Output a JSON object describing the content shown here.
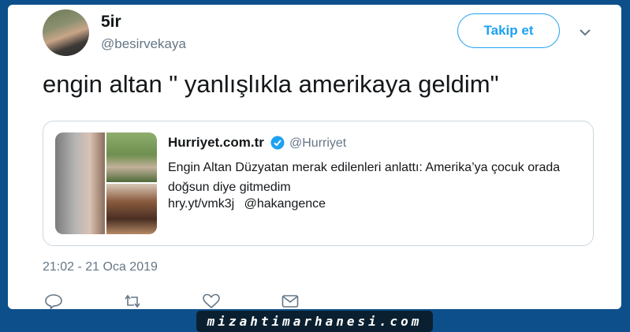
{
  "tweet": {
    "display_name": "5ir",
    "handle": "@besirvekaya",
    "follow_label": "Takip et",
    "text": "engin altan \" yanlışlıkla amerikaya geldim\"",
    "timestamp": "21:02 - 21 Oca 2019"
  },
  "quote": {
    "name": "Hurriyet.com.tr",
    "handle": "@Hurriyet",
    "text": "Engin Altan Düzyatan merak edilenleri anlattı: Amerika’ya çocuk orada doğsun diye gitmedim",
    "link": "hry.yt/vmk3j",
    "mention": "@hakangence"
  },
  "colors": {
    "accent": "#1da1f2",
    "page_background": "#0d4f8b",
    "secondary_text": "#657786"
  },
  "icons": [
    "reply-icon",
    "retweet-icon",
    "like-icon",
    "message-icon",
    "chevron-down-icon",
    "verified-icon"
  ],
  "footer": {
    "watermark": "mizahtimarhanesi.com"
  }
}
